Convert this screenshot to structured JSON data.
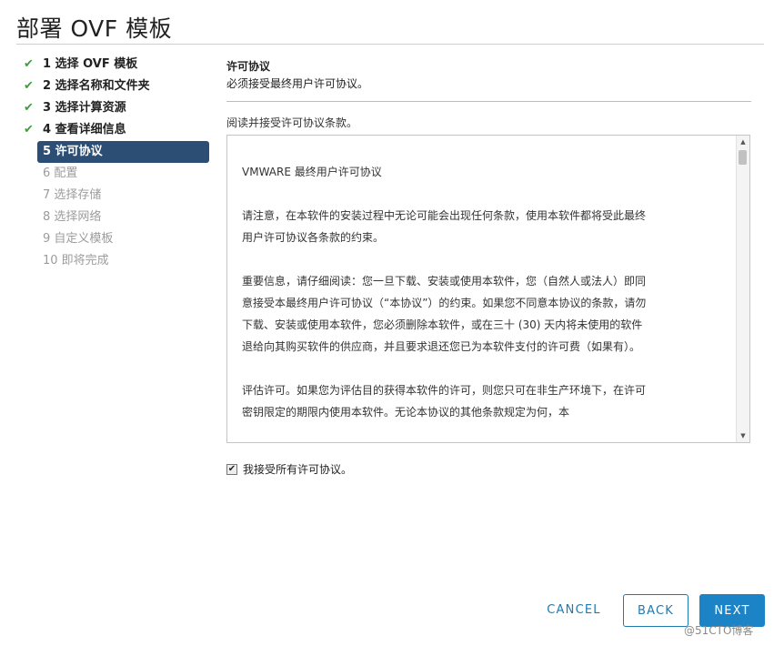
{
  "title": "部署 OVF 模板",
  "steps": [
    {
      "label": "1 选择 OVF 模板",
      "state": "done"
    },
    {
      "label": "2 选择名称和文件夹",
      "state": "done"
    },
    {
      "label": "3 选择计算资源",
      "state": "done"
    },
    {
      "label": "4 查看详细信息",
      "state": "done"
    },
    {
      "label": "5 许可协议",
      "state": "active"
    },
    {
      "label": "6 配置",
      "state": "future"
    },
    {
      "label": "7 选择存储",
      "state": "future"
    },
    {
      "label": "8 选择网络",
      "state": "future"
    },
    {
      "label": "9 自定义模板",
      "state": "future"
    },
    {
      "label": "10 即将完成",
      "state": "future"
    }
  ],
  "check_glyph": "✔",
  "section": {
    "title": "许可协议",
    "subtitle": "必须接受最终用户许可协议。",
    "read_label": "阅读并接受许可协议条款。"
  },
  "eula": {
    "paragraphs": [
      "VMWARE 最终用户许可协议",
      "请注意，在本软件的安装过程中无论可能会出现任何条款，使用本软件都将受此最终用户许可协议各条款的约束。",
      "重要信息，请仔细阅读：您一旦下载、安装或使用本软件，您（自然人或法人）即同意接受本最终用户许可协议（“本协议”）的约束。如果您不同意本协议的条款，请勿下载、安装或使用本软件，您必须删除本软件，或在三十 (30) 天内将未使用的软件退给向其购买软件的供应商，并且要求退还您已为本软件支付的许可费（如果有）。",
      "评估许可。如果您为评估目的获得本软件的许可，则您只可在非生产环境下，在许可密钥限定的期限内使用本软件。无论本协议的其他条款规定为何，本"
    ]
  },
  "accept": {
    "label": "我接受所有许可协议。",
    "checked": true
  },
  "buttons": {
    "cancel": "CANCEL",
    "back": "BACK",
    "next": "NEXT"
  },
  "watermark": "@51CTO博客",
  "colors": {
    "active_step": "#2c4e74",
    "check": "#3f9f3f",
    "primary": "#1c84c6",
    "link": "#1f7ab0"
  }
}
